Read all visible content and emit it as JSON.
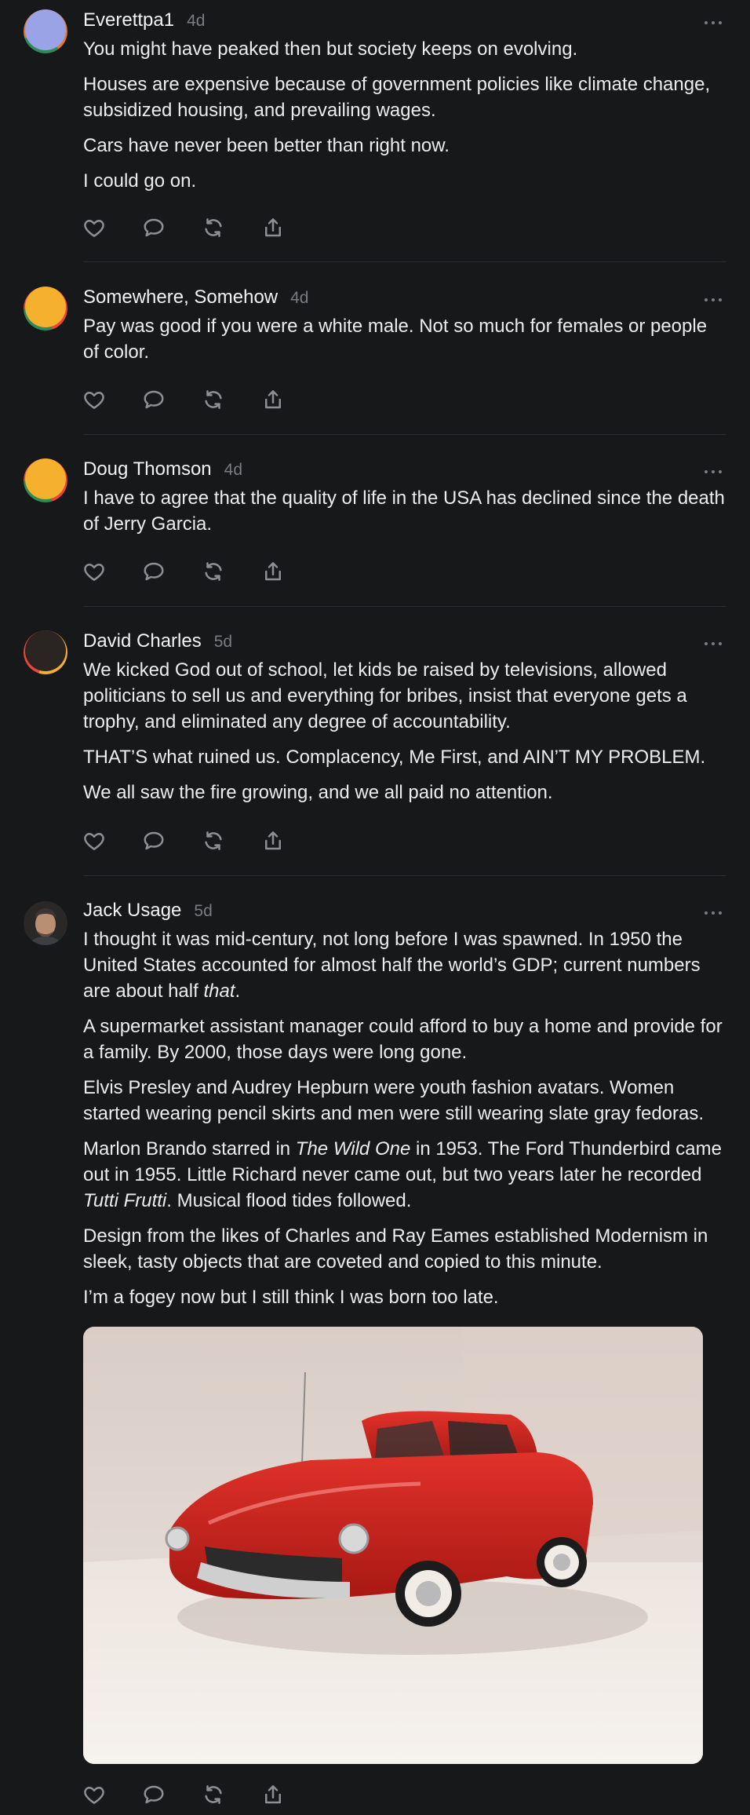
{
  "comments": [
    {
      "author": "Everettpa1",
      "time": "4d",
      "avatar_colors": [
        "#9aa3e6",
        "#e07a2e",
        "#2e8b57"
      ],
      "paragraphs": [
        "You might have peaked then but society keeps on evolving.",
        "Houses are expensive because of government policies like climate change, subsidized housing, and prevailing wages.",
        "Cars have never been better than right now.",
        "I could go on."
      ]
    },
    {
      "author": "Somewhere, Somehow",
      "time": "4d",
      "avatar_colors": [
        "#f5b02e",
        "#e9453a",
        "#2e8b57"
      ],
      "paragraphs": [
        "Pay was good if you were a white male. Not so much for females or people of color."
      ]
    },
    {
      "author": "Doug Thomson",
      "time": "4d",
      "avatar_colors": [
        "#f5b02e",
        "#e9453a",
        "#2e8b57"
      ],
      "paragraphs": [
        "I have to agree that the quality of life in the USA has declined since the death of Jerry Garcia."
      ]
    },
    {
      "author": "David Charles",
      "time": "5d",
      "avatar_colors": [
        "#2a2523",
        "#e9453a",
        "#f5b02e"
      ],
      "paragraphs": [
        "We kicked God out of school, let kids be raised by televisions, allowed politicians to sell us and everything for bribes, insist that everyone gets a trophy, and eliminated any degree of accountability.",
        "THAT’S what ruined us. Complacency, Me First, and AIN’T MY PROBLEM.",
        "We all saw the fire growing, and we all paid no attention."
      ]
    },
    {
      "author": "Jack Usage",
      "time": "5d",
      "paragraphs": {
        "p1_a": "I thought it was mid-century, not long before I was spawned. In 1950 the United States accounted for almost half the world’s GDP; current numbers are about half ",
        "p1_em": "that",
        "p1_b": ".",
        "p2": "A supermarket assistant manager could afford to buy a home and provide for a family. By 2000, those days were long gone.",
        "p3": "Elvis Presley and Audrey Hepburn were youth fashion avatars. Women started wearing pencil skirts and men were still wearing slate gray fedoras.",
        "p4_a": "Marlon Brando starred in ",
        "p4_em1": "The Wild One",
        "p4_b": " in 1953. The Ford Thunderbird came out in 1955. Little Richard never came out, but two years later he recorded ",
        "p4_em2": "Tutti Frutti",
        "p4_c": ". Musical flood tides followed.",
        "p5": "Design from the likes of Charles and Ray Eames established Modernism in sleek, tasty objects that are coveted and copied to this minute.",
        "p6": "I’m a fogey now but I still think I was born too late."
      }
    }
  ],
  "icons": {
    "like": "heart-icon",
    "reply": "comment-bubble-icon",
    "repost": "repost-icon",
    "share": "share-icon",
    "more": "more-dots-icon"
  },
  "colors": {
    "background": "#17181a",
    "text": "#ececec",
    "muted": "#7b7b80",
    "icon": "#8e8e93",
    "car": "#d3231d"
  }
}
